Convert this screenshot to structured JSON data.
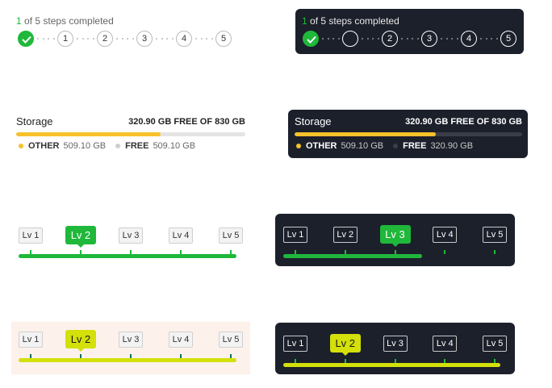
{
  "steps_light": {
    "caption_num": "1",
    "caption_text": " of 5 steps completed",
    "steps": [
      "",
      "1",
      "2",
      "3",
      "4",
      "5"
    ]
  },
  "steps_dark": {
    "caption_num": "1",
    "caption_text": " of 5 steps completed",
    "steps": [
      "",
      "",
      "2",
      "3",
      "4",
      "5"
    ]
  },
  "storage_light": {
    "title": "Storage",
    "summary": "320.90 GB FREE OF 830 GB",
    "used_fraction": 0.63,
    "legend": [
      {
        "label": "OTHER",
        "value": "509.10 GB",
        "color": "#f6c12a"
      },
      {
        "label": "FREE",
        "value": "509.10 GB",
        "color": "#cfcfcf"
      }
    ]
  },
  "storage_dark": {
    "title": "Storage",
    "summary": "320.90 GB FREE OF 830 GB",
    "used_fraction": 0.62,
    "legend": [
      {
        "label": "OTHER",
        "value": "509.10 GB",
        "color": "#f6c12a"
      },
      {
        "label": "FREE",
        "value": "320.90 GB",
        "color": "#3a3e48"
      }
    ]
  },
  "level_green_light": {
    "levels": [
      "Lv 1",
      "Lv 2",
      "Lv 3",
      "Lv 4",
      "Lv 5"
    ],
    "active": "Lv 2"
  },
  "level_green_dark": {
    "levels": [
      "Lv 1",
      "Lv 2",
      "Lv 3",
      "Lv 4",
      "Lv 5"
    ],
    "active": "Lv 3"
  },
  "level_lime_light": {
    "levels": [
      "Lv 1",
      "Lv 2",
      "Lv 3",
      "Lv 4",
      "Lv 5"
    ],
    "active": "Lv 2"
  },
  "level_lime_dark": {
    "levels": [
      "Lv 1",
      "Lv 2",
      "Lv 3",
      "Lv 4",
      "Lv 5"
    ],
    "active": "Lv 2"
  },
  "colors": {
    "green": "#1fb83a",
    "lime": "#d3e00a",
    "storage_yellow": "#f6c12a",
    "dark_panel": "#1c202b"
  }
}
